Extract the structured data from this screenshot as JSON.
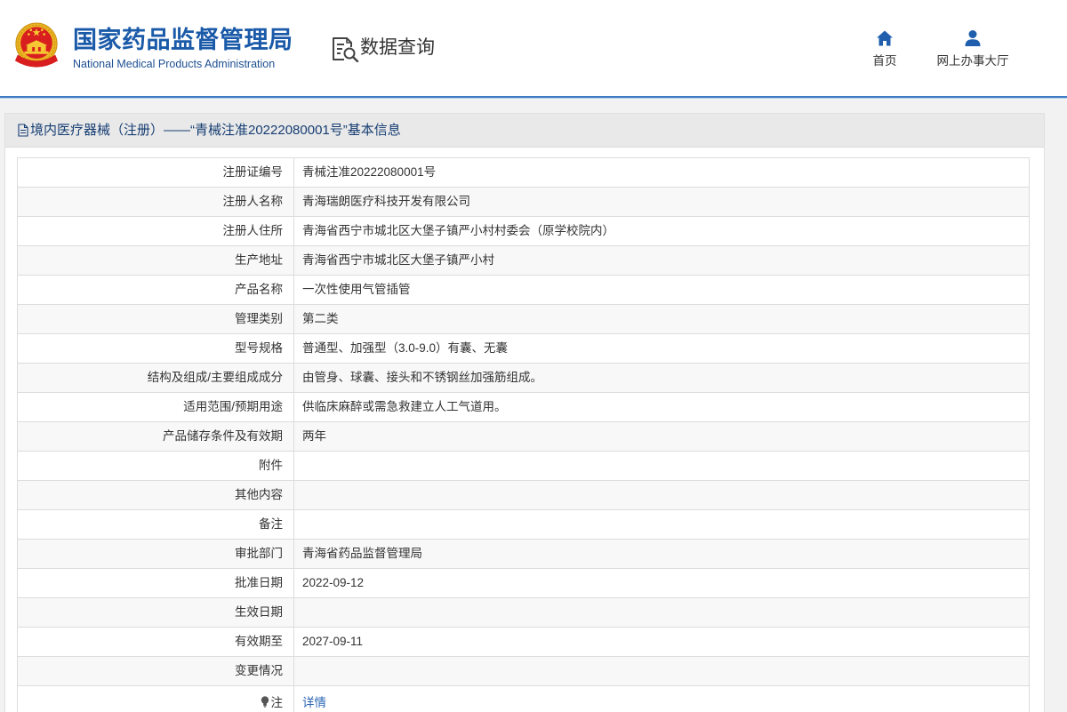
{
  "header": {
    "logo_icon": "national-emblem",
    "title_cn": "国家药品监督管理局",
    "title_en": "National Medical Products Administration",
    "section_icon": "data-query-icon",
    "section_title": "数据查询",
    "nav": [
      {
        "label": "首页",
        "icon": "home-icon"
      },
      {
        "label": "网上办事大厅",
        "icon": "user-icon"
      }
    ]
  },
  "panel": {
    "title_icon": "document-icon",
    "title": "境内医疗器械（注册）——“青械注准20222080001号”基本信息",
    "rows": [
      {
        "label": "注册证编号",
        "value": "青械注准20222080001号"
      },
      {
        "label": "注册人名称",
        "value": "青海瑞朗医疗科技开发有限公司"
      },
      {
        "label": "注册人住所",
        "value": "青海省西宁市城北区大堡子镇严小村村委会（原学校院内）"
      },
      {
        "label": "生产地址",
        "value": "青海省西宁市城北区大堡子镇严小村"
      },
      {
        "label": "产品名称",
        "value": "一次性使用气管插管"
      },
      {
        "label": "管理类别",
        "value": "第二类"
      },
      {
        "label": "型号规格",
        "value": "普通型、加强型（3.0-9.0）有囊、无囊"
      },
      {
        "label": "结构及组成/主要组成成分",
        "value": "由管身、球囊、接头和不锈钢丝加强筋组成。"
      },
      {
        "label": "适用范围/预期用途",
        "value": "供临床麻醉或需急救建立人工气道用。"
      },
      {
        "label": "产品储存条件及有效期",
        "value": "两年"
      },
      {
        "label": "附件",
        "value": ""
      },
      {
        "label": "其他内容",
        "value": ""
      },
      {
        "label": "备注",
        "value": ""
      },
      {
        "label": "审批部门",
        "value": "青海省药品监督管理局"
      },
      {
        "label": "批准日期",
        "value": "2022-09-12"
      },
      {
        "label": "生效日期",
        "value": ""
      },
      {
        "label": "有效期至",
        "value": "2027-09-11"
      },
      {
        "label": "变更情况",
        "value": ""
      },
      {
        "label": "注",
        "value": "详情",
        "icon": "bulb-icon",
        "is_link": true
      }
    ]
  },
  "theme": {
    "brand_blue": "#1a5aa8",
    "nav_icon_blue": "#1f5fae",
    "link_blue": "#2a64b4",
    "header_line": "#3f7cc4",
    "title_bar_bg": "#e9e9e9",
    "panel_title_color": "#163d73"
  }
}
